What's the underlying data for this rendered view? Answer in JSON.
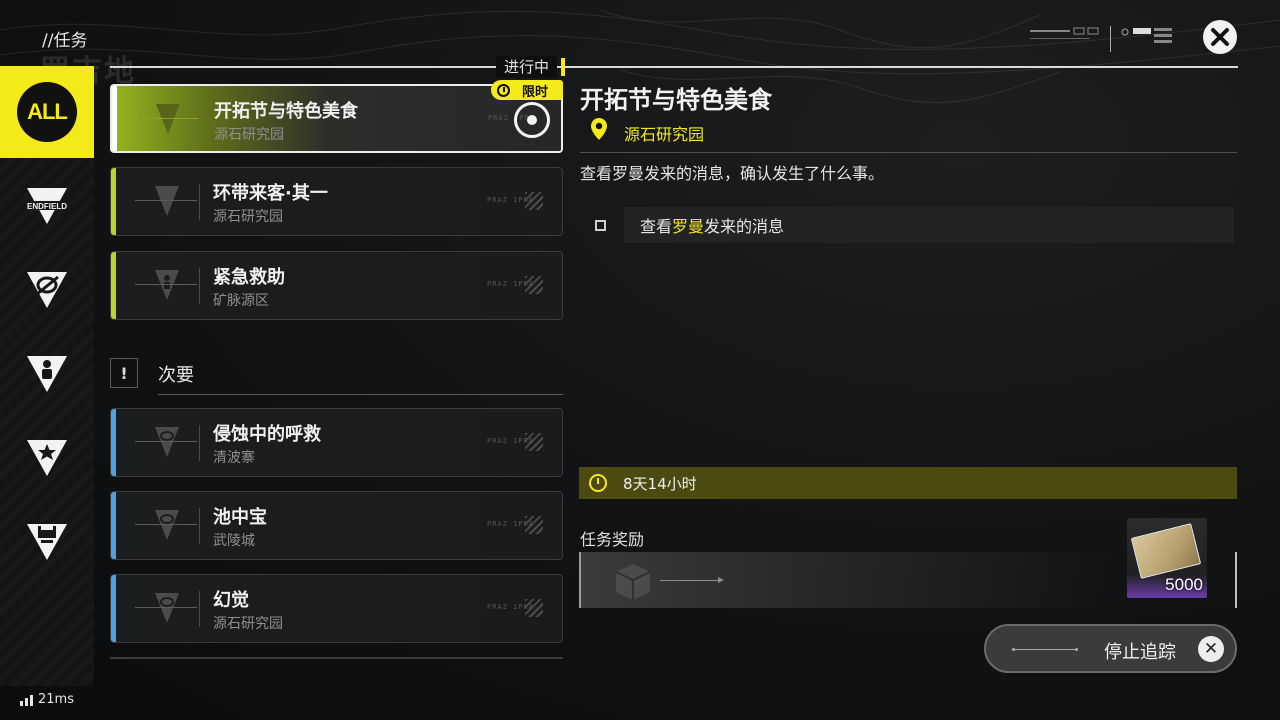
{
  "header": {
    "title": "//任务",
    "watermark": "罗吉地"
  },
  "sidebar": {
    "items": [
      {
        "label": "ALL",
        "active": true
      },
      {
        "icon": "endfield-icon",
        "label": "ENDFIELD"
      },
      {
        "icon": "event-icon"
      },
      {
        "icon": "person-icon"
      },
      {
        "icon": "star-icon"
      },
      {
        "icon": "facility-icon"
      }
    ]
  },
  "status": {
    "in_progress": "进行中",
    "limited_badge": "限时"
  },
  "quests": [
    {
      "title": "开拓节与特色美食",
      "location": "源石研究园",
      "code": "PRAZ 1PRA",
      "selected": true
    },
    {
      "title": "环带来客·其一",
      "location": "源石研究园",
      "code": "PRAZ 1PRA"
    },
    {
      "title": "紧急救助",
      "location": "矿脉源区",
      "code": "PRAZ 1PRA"
    }
  ],
  "secondary": {
    "badge": "!",
    "label": "次要",
    "quests": [
      {
        "title": "侵蚀中的呼救",
        "location": "清波寨",
        "code": "PRAZ 1PRA"
      },
      {
        "title": "池中宝",
        "location": "武陵城",
        "code": "PRAZ 1PRA"
      },
      {
        "title": "幻觉",
        "location": "源石研究园",
        "code": "PRAZ 1PRA"
      }
    ]
  },
  "detail": {
    "title": "开拓节与特色美食",
    "location": "源石研究园",
    "description": "查看罗曼发来的消息，确认发生了什么事。",
    "objective": {
      "before": "查看",
      "highlight": "罗曼",
      "after": "发来的消息"
    },
    "timer": "8天14小时",
    "reward_label": "任务奖励",
    "reward_qty": "5000"
  },
  "stop_tracking": "停止追踪",
  "ping": "21ms",
  "colors": {
    "accent": "#f4ea1a",
    "primary_stripe": "#b6d629",
    "secondary_stripe": "#4da3df"
  }
}
